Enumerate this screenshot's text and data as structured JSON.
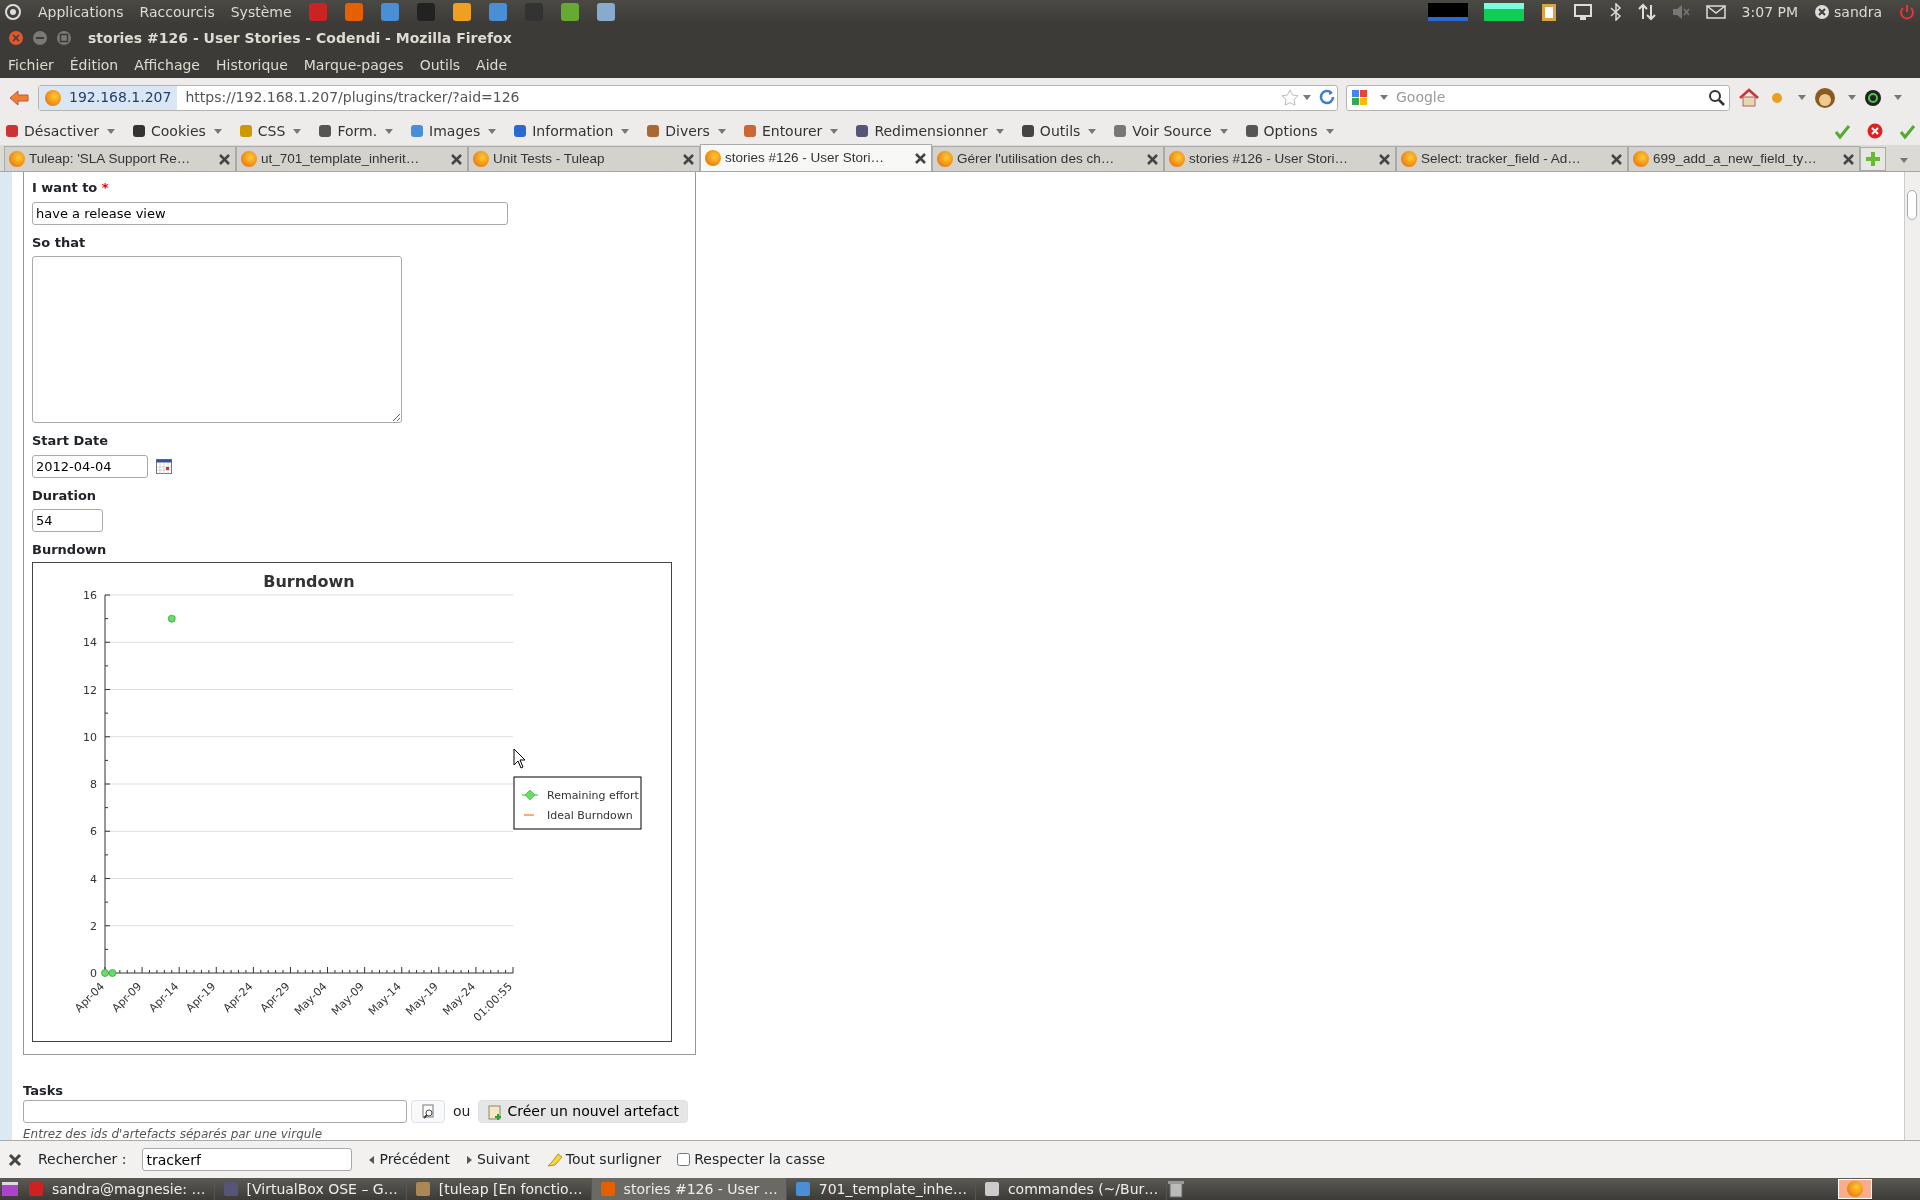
{
  "top_panel": {
    "menus": [
      "Applications",
      "Raccourcis",
      "Système"
    ],
    "clock": "3:07 PM",
    "user": "sandra"
  },
  "window": {
    "title": "stories #126 - User Stories - Codendi - Mozilla Firefox"
  },
  "menu_bar": [
    "Fichier",
    "Édition",
    "Affichage",
    "Historique",
    "Marque-pages",
    "Outils",
    "Aide"
  ],
  "nav_bar": {
    "identity": "192.168.1.207",
    "url": "https://192.168.1.207/plugins/tracker/?aid=126",
    "search_placeholder": "Google"
  },
  "dev_toolbar": [
    "Désactiver",
    "Cookies",
    "CSS",
    "Form.",
    "Images",
    "Information",
    "Divers",
    "Entourer",
    "Redimensionner",
    "Outils",
    "Voir Source",
    "Options"
  ],
  "tabs": [
    {
      "label": "Tuleap: 'SLA Support Re…",
      "selected": false
    },
    {
      "label": "ut_701_template_inherit…",
      "selected": false
    },
    {
      "label": "Unit Tests - Tuleap",
      "selected": false
    },
    {
      "label": "stories #126 - User Stori…",
      "selected": true
    },
    {
      "label": "Gérer l'utilisation des ch…",
      "selected": false
    },
    {
      "label": "stories #126 - User Stori…",
      "selected": false
    },
    {
      "label": "Select: tracker_field - Ad…",
      "selected": false
    },
    {
      "label": "699_add_a_new_field_ty…",
      "selected": false
    }
  ],
  "form": {
    "fields": [
      {
        "kind": "text",
        "label": "I want to",
        "required_mark": "*",
        "value": "have a release view"
      },
      {
        "kind": "textarea",
        "label": "So that"
      },
      {
        "kind": "date",
        "label": "Start Date",
        "value": "2012-04-04"
      },
      {
        "kind": "number",
        "label": "Duration",
        "value": "54"
      }
    ],
    "chart_label": "Burndown",
    "chart_data": {
      "type": "scatter",
      "title": "Burndown",
      "categories": [
        "Apr-04",
        null,
        null,
        null,
        null,
        "Apr-09",
        null,
        null,
        null,
        null,
        "Apr-14",
        null,
        null,
        null,
        null,
        "Apr-19",
        null,
        null,
        null,
        null,
        "Apr-24",
        null,
        null,
        null,
        null,
        "Apr-29",
        null,
        null,
        null,
        null,
        "May-04",
        null,
        null,
        null,
        null,
        "May-09",
        null,
        null,
        null,
        null,
        "May-14",
        null,
        null,
        null,
        null,
        "May-19",
        null,
        null,
        null,
        null,
        "May-24",
        null,
        null,
        null,
        null,
        "01:00:55"
      ],
      "series": [
        {
          "name": "Remaining effort",
          "color": "#66dd66",
          "values": [
            0,
            0,
            null,
            null,
            null,
            null,
            null,
            null,
            null,
            15,
            null,
            null,
            null,
            null,
            null,
            null,
            null,
            null,
            null,
            null,
            null,
            null,
            null,
            null,
            null,
            null,
            null,
            null,
            null,
            null,
            null,
            null,
            null,
            null,
            null,
            null,
            null,
            null,
            null,
            null,
            null,
            null,
            null,
            null,
            null,
            null,
            null,
            null,
            null,
            null,
            null,
            null,
            null,
            null,
            null,
            null
          ]
        },
        {
          "name": "Ideal Burndown",
          "color": "#ffaa77",
          "values": [
            null,
            null,
            null,
            null,
            null,
            null,
            null,
            null,
            null,
            null,
            null,
            null,
            null,
            null,
            null,
            null,
            null,
            null,
            null,
            null,
            null,
            null,
            null,
            null,
            null,
            null,
            null,
            null,
            null,
            null,
            null,
            null,
            null,
            null,
            null,
            null,
            null,
            null,
            null,
            null,
            null,
            null,
            null,
            null,
            null,
            null,
            null,
            null,
            null,
            null,
            null,
            null,
            null,
            null,
            null,
            null
          ]
        }
      ],
      "ylim": [
        0,
        16
      ],
      "grid": true,
      "yticks": [
        0,
        2,
        4,
        6,
        8,
        10,
        12,
        14,
        16
      ]
    },
    "tasks": {
      "label": "Tasks",
      "or": "ou",
      "create_button": "Créer un nouvel artefact",
      "hint": "Entrez des ids d'artefacts séparés par une virgule"
    }
  },
  "find_bar": {
    "label": "Rechercher :",
    "value": "trackerf",
    "previous": "Précédent",
    "next": "Suivant",
    "highlight": "Tout surligner",
    "match_case": {
      "label": "Respecter la casse",
      "checked": false
    }
  },
  "taskbar": [
    {
      "label": "sandra@magnesie: …",
      "selected": false
    },
    {
      "label": "[VirtualBox OSE – G…",
      "selected": false
    },
    {
      "label": "[tuleap [En fonctio…",
      "selected": false
    },
    {
      "label": "stories #126 - User …",
      "selected": true
    },
    {
      "label": "701_template_inhe…",
      "selected": false
    },
    {
      "label": "commandes (~/Bur…",
      "selected": false
    }
  ]
}
